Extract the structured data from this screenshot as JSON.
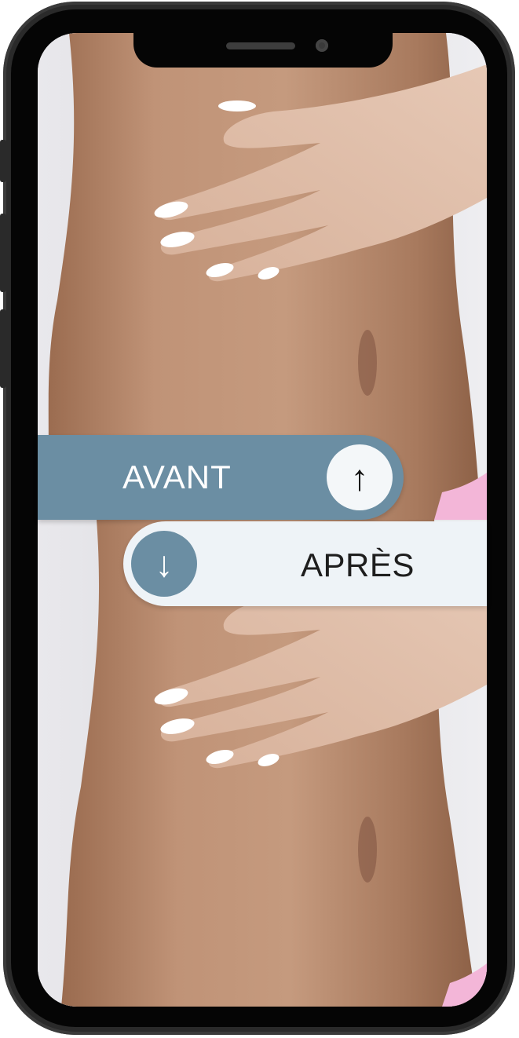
{
  "labels": {
    "before": "AVANT",
    "after": "APRÈS"
  },
  "icons": {
    "before": "arrow-up-icon",
    "after": "arrow-down-icon",
    "before_glyph": "↑",
    "after_glyph": "↓"
  },
  "colors": {
    "accent": "#6b8ea3",
    "light_bar": "#eef3f7",
    "phone_frame": "#2a2a2a",
    "skin_tone": "#b88a6a",
    "bikini": "#f3b6d8"
  }
}
